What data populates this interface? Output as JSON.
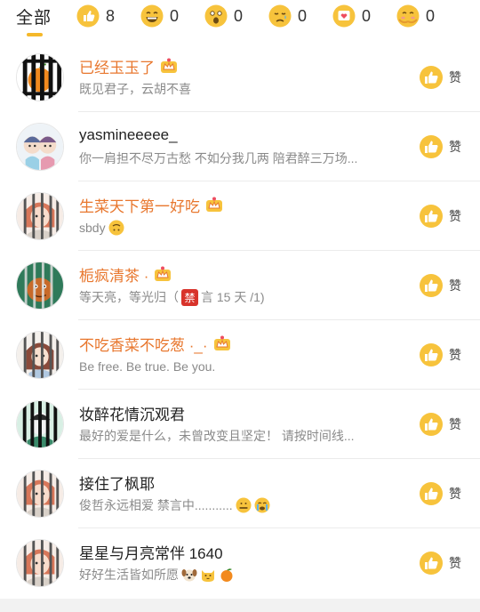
{
  "tabs": {
    "all_label": "全部",
    "reactions": [
      {
        "icon": "thumbs-up-emoji",
        "count": "8"
      },
      {
        "icon": "laughing-emoji",
        "count": "0"
      },
      {
        "icon": "surprised-emoji",
        "count": "0"
      },
      {
        "icon": "sad-emoji",
        "count": "0"
      },
      {
        "icon": "heart-box-emoji",
        "count": "0"
      },
      {
        "icon": "hug-emoji",
        "count": "0"
      }
    ]
  },
  "like_label": "赞",
  "ban_badge": "禁",
  "colors": {
    "vip_name": "#e8772e",
    "accent": "#f5b82a",
    "like": "#f7c33c"
  },
  "users": [
    {
      "name": "已经玉玉了",
      "vip": true,
      "crown": true,
      "bio": "既见君子，云胡不喜"
    },
    {
      "name": "yasmineeeee_",
      "vip": false,
      "crown": false,
      "bio": "你一肩担不尽万古愁 不如分我几两 陪君醉三万场..."
    },
    {
      "name": "生菜天下第一好吃",
      "vip": true,
      "crown": true,
      "bio": "sbdy"
    },
    {
      "name": "栀疯清茶 ·",
      "vip": true,
      "crown": true,
      "bio_prefix": "等天亮，等光归（",
      "bio_suffix": "言 15 天 /1)"
    },
    {
      "name": "不吃香菜不吃葱 ·_·",
      "vip": true,
      "crown": true,
      "bio": "Be free.   Be true.   Be you."
    },
    {
      "name": "妆醉花情沉观君",
      "vip": false,
      "crown": false,
      "bio": "最好的爱是什么，未曾改变且坚定！ 请按时间线..."
    },
    {
      "name": "接住了枫耶",
      "vip": false,
      "crown": false,
      "bio": "俊哲永远相爱 禁言中..........."
    },
    {
      "name": "星星与月亮常伴 1640",
      "vip": false,
      "crown": false,
      "bio": "好好生活皆如所愿"
    }
  ]
}
